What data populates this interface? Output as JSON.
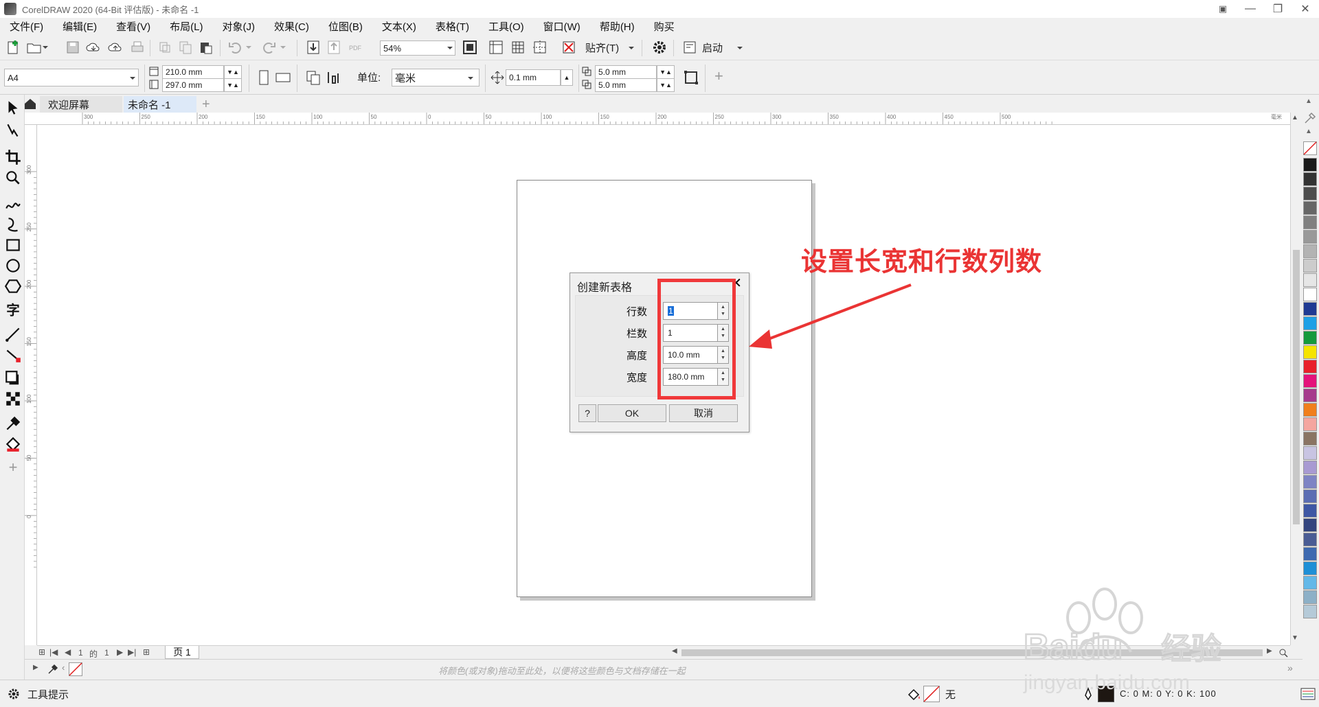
{
  "window": {
    "title": "CorelDRAW 2020 (64-Bit 评估版) - 未命名 -1"
  },
  "menu": [
    "文件(F)",
    "编辑(E)",
    "查看(V)",
    "布局(L)",
    "对象(J)",
    "效果(C)",
    "位图(B)",
    "文本(X)",
    "表格(T)",
    "工具(O)",
    "窗口(W)",
    "帮助(H)",
    "购买"
  ],
  "toolbar": {
    "zoom": "54%",
    "snap_label": "贴齐(T)",
    "launch_label": "启动",
    "page_size": "A4",
    "width": "210.0 mm",
    "height": "297.0 mm",
    "units_label": "单位:",
    "units_value": "毫米",
    "nudge": "0.1 mm",
    "dup_x": "5.0 mm",
    "dup_y": "5.0 mm",
    "pdf_label": "PDF"
  },
  "tabs": {
    "welcome": "欢迎屏幕",
    "doc": "未命名 -1"
  },
  "ruler": {
    "h_ticks": [
      "300",
      "250",
      "200",
      "150",
      "100",
      "50",
      "0",
      "50",
      "100",
      "150",
      "200",
      "250",
      "300",
      "350",
      "400",
      "450",
      "500"
    ],
    "h_unit": "毫米",
    "v_ticks": [
      "300",
      "250",
      "200",
      "150",
      "100",
      "50",
      "0"
    ]
  },
  "dialog": {
    "title": "创建新表格",
    "rows_label": "行数",
    "rows_value": "1",
    "cols_label": "栏数",
    "cols_value": "1",
    "height_label": "高度",
    "height_value": "10.0 mm",
    "width_label": "宽度",
    "width_value": "180.0 mm",
    "help_label": "?",
    "ok_label": "OK",
    "cancel_label": "取消"
  },
  "annotation": {
    "text": "设置长宽和行数列数",
    "color": "#ea3434"
  },
  "pagebar": {
    "current": "1",
    "of": "的",
    "total": "1",
    "page_tab": "页 1"
  },
  "docpalette": {
    "hint": "将颜色(或对象)拖动至此处，以便将这些颜色与文档存储在一起"
  },
  "status": {
    "hints_label": "工具提示",
    "fill_label": "无",
    "color_readout": "C: 0 M: 0 Y: 0 K: 100"
  },
  "palette_colors": [
    "#1a1a1a",
    "#333333",
    "#4d4d4d",
    "#666666",
    "#808080",
    "#999999",
    "#b3b3b3",
    "#cccccc",
    "#e6e6e6",
    "#ffffff",
    "#1f3a93",
    "#1ea0e6",
    "#159a3c",
    "#f5e400",
    "#e8202a",
    "#e4137b",
    "#a63a8c",
    "#f07f1d",
    "#f4a6a0",
    "#8a7463",
    "#c8c4e2",
    "#a89ad2",
    "#7e84c4",
    "#5b6db3",
    "#3e57a4",
    "#34457e",
    "#4a5c94",
    "#3e6ab0",
    "#1e8fd6",
    "#63b8e8",
    "#8db0c7",
    "#b5cad8"
  ],
  "watermark": {
    "brand": "Baidu",
    "cn": "经验",
    "url": "jingyan.baidu.com"
  }
}
